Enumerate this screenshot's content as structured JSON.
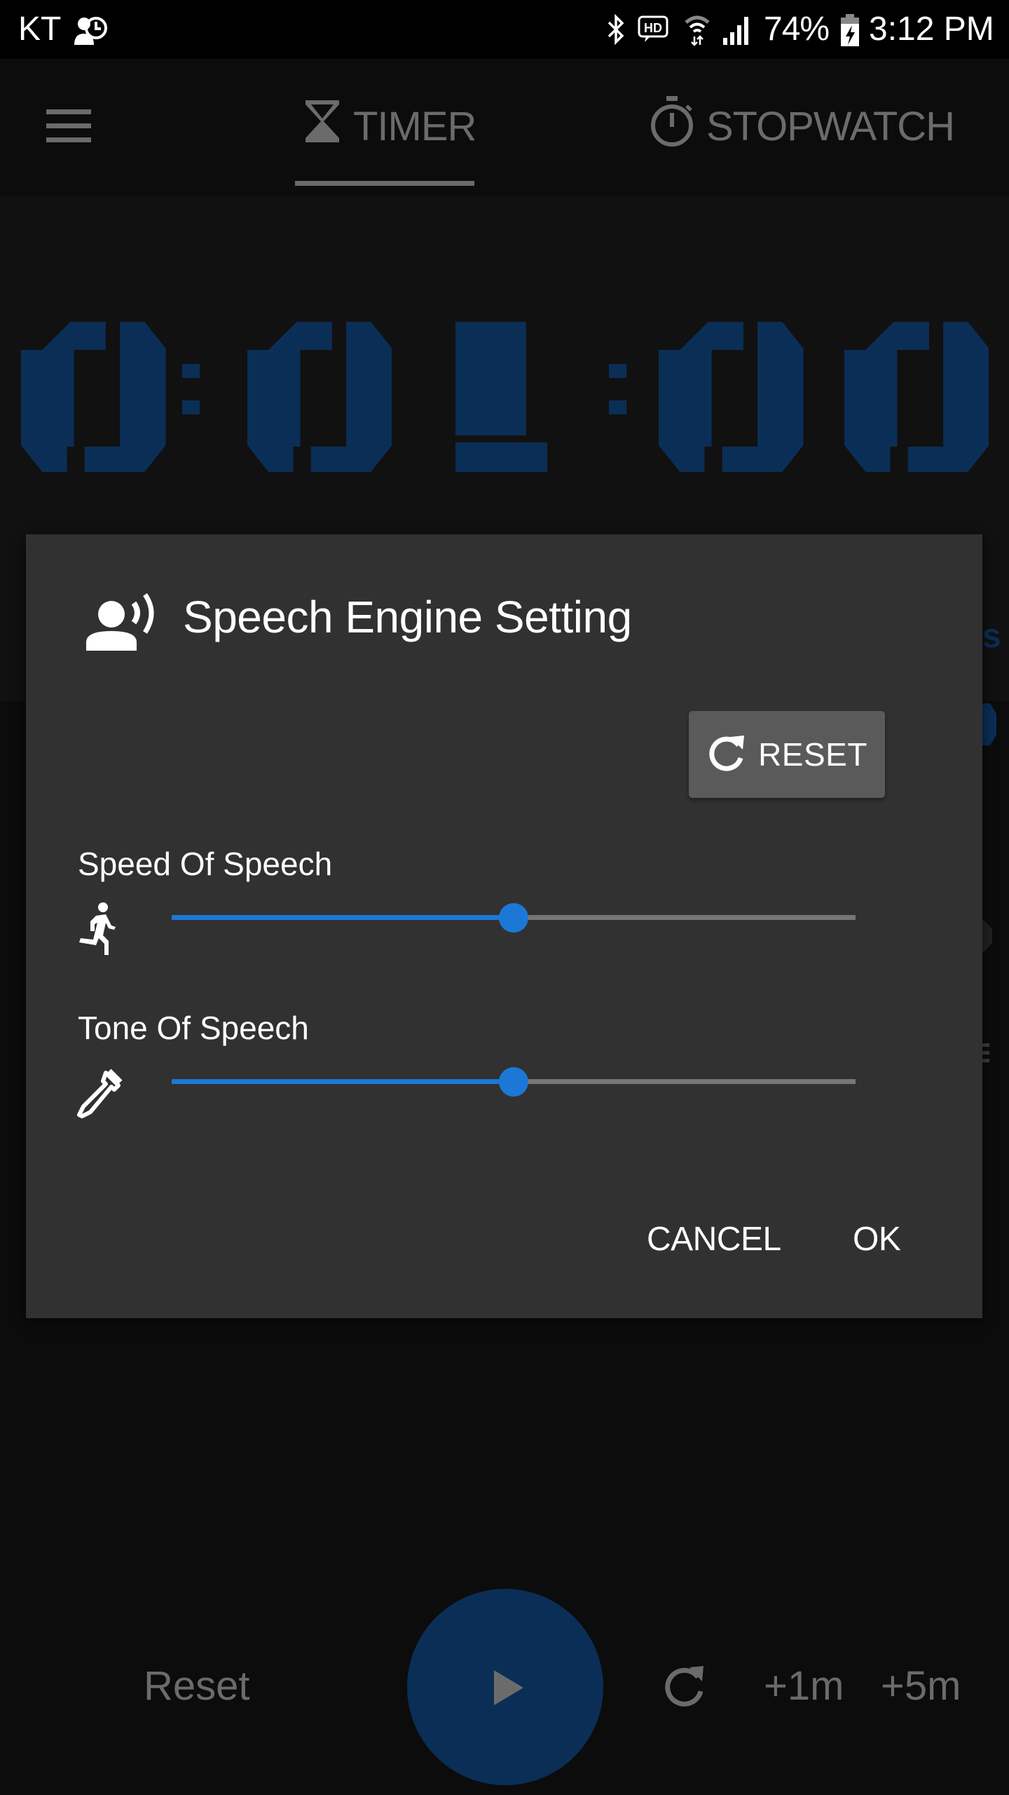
{
  "status_bar": {
    "carrier": "KT",
    "battery_percent": "74%",
    "time": "3:12 PM",
    "icons": [
      "user-clock-icon",
      "bluetooth-icon",
      "hd-voice-icon",
      "wifi-icon",
      "signal-icon",
      "battery-charging-icon"
    ]
  },
  "header": {
    "menu_icon": "hamburger-icon",
    "tabs": [
      {
        "label": "TIMER",
        "icon": "hourglass-icon",
        "active": true
      },
      {
        "label": "STOPWATCH",
        "icon": "stopwatch-icon",
        "active": false
      }
    ]
  },
  "timer": {
    "display": "0:01:00",
    "digits": [
      "0",
      ":",
      "0",
      "1",
      ":",
      "0",
      "0"
    ],
    "color": "#0b2e56"
  },
  "background_peek": {
    "letter": "s"
  },
  "controls": {
    "reset_label": "Reset",
    "play_icon": "play-icon",
    "repeat_icon": "refresh-icon",
    "plus1_label": "+1m",
    "plus5_label": "+5m"
  },
  "dialog": {
    "title": "Speech Engine Setting",
    "title_icon": "voice-speaking-icon",
    "reset_button_label": "RESET",
    "settings": [
      {
        "label": "Speed Of Speech",
        "icon": "running-person-icon",
        "value": 0.5
      },
      {
        "label": "Tone Of Speech",
        "icon": "eyedropper-icon",
        "value": 0.5
      }
    ],
    "cancel_label": "CANCEL",
    "ok_label": "OK"
  },
  "colors": {
    "accent": "#1c78d6",
    "dialog_bg": "#313131",
    "dimmed_text": "#6b6b6b",
    "timer_blue": "#0b2e56"
  }
}
